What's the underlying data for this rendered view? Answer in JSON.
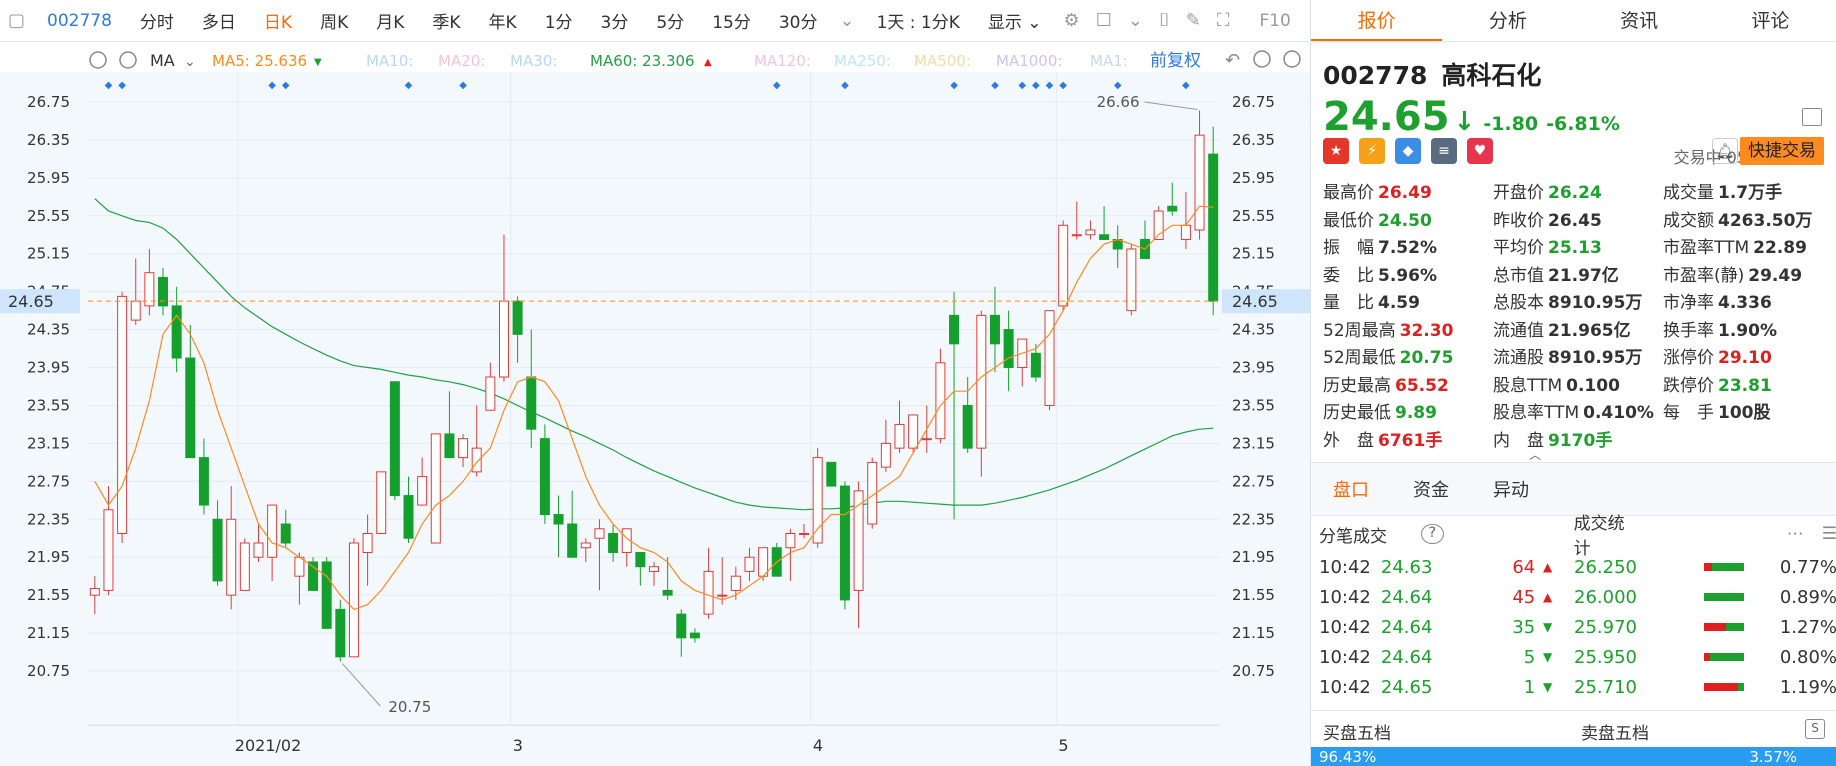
{
  "toolbar": {
    "code": "002778",
    "periods": [
      "分时",
      "多日",
      "日K",
      "周K",
      "月K",
      "季K",
      "年K",
      "1分",
      "3分",
      "5分",
      "15分",
      "30分"
    ],
    "active_period": "日K",
    "multi": "1天 : 1分K",
    "display": "显示",
    "f10": "F10"
  },
  "chart": {
    "ma_label": "MA",
    "ma_items": [
      {
        "label": "MA5: 25.636",
        "color": "#ff8a1f"
      },
      {
        "label": "MA10:",
        "color": "#b9d6f2"
      },
      {
        "label": "MA20:",
        "color": "#f3c3da"
      },
      {
        "label": "MA30:",
        "color": "#b9d6f2"
      },
      {
        "label": "MA60: 23.306",
        "color": "#23a045"
      },
      {
        "label": "MA120:",
        "color": "#f3c3da"
      },
      {
        "label": "MA250:",
        "color": "#bfe6f2"
      },
      {
        "label": "MA500:",
        "color": "#f6d9a6"
      },
      {
        "label": "MA1000:",
        "color": "#d3c2ea"
      },
      {
        "label": "MA1:",
        "color": "#c9d8e8"
      }
    ],
    "adjust": "前复权",
    "yticks": [
      "26.75",
      "26.35",
      "25.95",
      "25.55",
      "25.15",
      "24.75",
      "24.35",
      "23.95",
      "23.55",
      "23.15",
      "22.75",
      "22.35",
      "21.95",
      "21.55",
      "21.15",
      "20.75"
    ],
    "current_price_label": "24.65",
    "max_label": "26.66",
    "min_label": "20.75",
    "xlabels": [
      "2021/02",
      "3",
      "4",
      "5"
    ],
    "colors": {
      "up": "#e23b3b",
      "down": "#15a02e",
      "ma5": "#ff8a1f",
      "ma60": "#23a045",
      "bg": "#f3f8fd",
      "grid": "#e3ebf3",
      "marker": "#2c7be5"
    }
  },
  "chart_data": {
    "type": "candlestick",
    "ylim": [
      20.55,
      26.95
    ],
    "candles": [
      {
        "o": 21.55,
        "h": 21.75,
        "l": 21.35,
        "c": 21.62
      },
      {
        "o": 21.6,
        "h": 22.7,
        "l": 21.55,
        "c": 22.45
      },
      {
        "o": 22.2,
        "h": 24.75,
        "l": 22.1,
        "c": 24.7
      },
      {
        "o": 24.45,
        "h": 25.1,
        "l": 24.4,
        "c": 24.65
      },
      {
        "o": 24.6,
        "h": 25.2,
        "l": 24.5,
        "c": 24.95
      },
      {
        "o": 24.9,
        "h": 25.0,
        "l": 24.5,
        "c": 24.6
      },
      {
        "o": 24.6,
        "h": 24.8,
        "l": 23.9,
        "c": 24.05
      },
      {
        "o": 24.05,
        "h": 24.4,
        "l": 23.0,
        "c": 23.0
      },
      {
        "o": 23.0,
        "h": 23.2,
        "l": 22.4,
        "c": 22.5
      },
      {
        "o": 22.35,
        "h": 22.55,
        "l": 21.65,
        "c": 21.7
      },
      {
        "o": 21.55,
        "h": 22.7,
        "l": 21.4,
        "c": 22.35
      },
      {
        "o": 21.6,
        "h": 22.15,
        "l": 21.6,
        "c": 22.1
      },
      {
        "o": 21.95,
        "h": 22.3,
        "l": 21.9,
        "c": 22.1
      },
      {
        "o": 21.95,
        "h": 22.5,
        "l": 21.7,
        "c": 22.5
      },
      {
        "o": 22.3,
        "h": 22.45,
        "l": 22.05,
        "c": 22.1
      },
      {
        "o": 21.75,
        "h": 22.0,
        "l": 21.45,
        "c": 21.95
      },
      {
        "o": 21.9,
        "h": 21.95,
        "l": 21.6,
        "c": 21.6
      },
      {
        "o": 21.9,
        "h": 21.95,
        "l": 21.2,
        "c": 21.2
      },
      {
        "o": 21.4,
        "h": 21.5,
        "l": 20.85,
        "c": 20.9
      },
      {
        "o": 20.9,
        "h": 22.15,
        "l": 20.9,
        "c": 22.1
      },
      {
        "o": 22.0,
        "h": 22.4,
        "l": 21.65,
        "c": 22.2
      },
      {
        "o": 22.2,
        "h": 22.85,
        "l": 22.2,
        "c": 22.85
      },
      {
        "o": 23.8,
        "h": 23.8,
        "l": 22.55,
        "c": 22.6
      },
      {
        "o": 22.6,
        "h": 22.8,
        "l": 22.1,
        "c": 22.15
      },
      {
        "o": 22.5,
        "h": 23.0,
        "l": 22.5,
        "c": 22.8
      },
      {
        "o": 22.1,
        "h": 23.25,
        "l": 22.1,
        "c": 23.25
      },
      {
        "o": 23.25,
        "h": 23.7,
        "l": 23.0,
        "c": 23.0
      },
      {
        "o": 23.0,
        "h": 23.25,
        "l": 22.9,
        "c": 23.2
      },
      {
        "o": 22.85,
        "h": 23.55,
        "l": 22.8,
        "c": 23.1
      },
      {
        "o": 23.5,
        "h": 24.0,
        "l": 23.5,
        "c": 23.85
      },
      {
        "o": 23.85,
        "h": 25.35,
        "l": 23.8,
        "c": 24.65
      },
      {
        "o": 24.65,
        "h": 24.7,
        "l": 24.0,
        "c": 24.3
      },
      {
        "o": 23.85,
        "h": 24.35,
        "l": 23.1,
        "c": 23.3
      },
      {
        "o": 23.2,
        "h": 23.35,
        "l": 22.3,
        "c": 22.4
      },
      {
        "o": 22.4,
        "h": 22.6,
        "l": 21.95,
        "c": 22.3
      },
      {
        "o": 22.3,
        "h": 22.65,
        "l": 21.95,
        "c": 21.95
      },
      {
        "o": 22.05,
        "h": 22.15,
        "l": 21.9,
        "c": 22.1
      },
      {
        "o": 22.15,
        "h": 22.35,
        "l": 21.6,
        "c": 22.25
      },
      {
        "o": 22.2,
        "h": 22.3,
        "l": 21.9,
        "c": 22.0
      },
      {
        "o": 22.0,
        "h": 22.25,
        "l": 21.85,
        "c": 22.25
      },
      {
        "o": 22.0,
        "h": 22.0,
        "l": 21.65,
        "c": 21.85
      },
      {
        "o": 21.8,
        "h": 21.9,
        "l": 21.65,
        "c": 21.85
      },
      {
        "o": 21.6,
        "h": 21.95,
        "l": 21.5,
        "c": 21.55
      },
      {
        "o": 21.35,
        "h": 21.4,
        "l": 20.9,
        "c": 21.1
      },
      {
        "o": 21.15,
        "h": 21.2,
        "l": 21.05,
        "c": 21.1
      },
      {
        "o": 21.35,
        "h": 22.05,
        "l": 21.3,
        "c": 21.8
      },
      {
        "o": 21.55,
        "h": 21.95,
        "l": 21.45,
        "c": 21.55
      },
      {
        "o": 21.6,
        "h": 21.85,
        "l": 21.5,
        "c": 21.75
      },
      {
        "o": 21.8,
        "h": 22.05,
        "l": 21.7,
        "c": 21.95
      },
      {
        "o": 21.75,
        "h": 22.05,
        "l": 21.7,
        "c": 22.05
      },
      {
        "o": 22.05,
        "h": 22.1,
        "l": 21.75,
        "c": 21.75
      },
      {
        "o": 22.05,
        "h": 22.25,
        "l": 21.7,
        "c": 22.2
      },
      {
        "o": 22.2,
        "h": 22.3,
        "l": 22.15,
        "c": 22.2
      },
      {
        "o": 22.1,
        "h": 23.1,
        "l": 22.05,
        "c": 23.0
      },
      {
        "o": 22.95,
        "h": 22.95,
        "l": 22.7,
        "c": 22.7
      },
      {
        "o": 22.7,
        "h": 22.75,
        "l": 21.4,
        "c": 21.5
      },
      {
        "o": 21.6,
        "h": 22.75,
        "l": 21.2,
        "c": 22.65
      },
      {
        "o": 22.3,
        "h": 23.0,
        "l": 22.25,
        "c": 22.95
      },
      {
        "o": 22.9,
        "h": 23.4,
        "l": 22.85,
        "c": 23.15
      },
      {
        "o": 23.1,
        "h": 23.6,
        "l": 23.05,
        "c": 23.35
      },
      {
        "o": 23.1,
        "h": 23.45,
        "l": 23.05,
        "c": 23.45
      },
      {
        "o": 23.2,
        "h": 23.55,
        "l": 23.05,
        "c": 23.2
      },
      {
        "o": 23.2,
        "h": 24.15,
        "l": 23.15,
        "c": 24.0
      },
      {
        "o": 24.5,
        "h": 24.75,
        "l": 22.35,
        "c": 24.2
      },
      {
        "o": 23.55,
        "h": 23.85,
        "l": 23.05,
        "c": 23.1
      },
      {
        "o": 23.1,
        "h": 24.55,
        "l": 22.8,
        "c": 24.5
      },
      {
        "o": 24.5,
        "h": 24.8,
        "l": 23.9,
        "c": 24.2
      },
      {
        "o": 24.35,
        "h": 24.55,
        "l": 23.7,
        "c": 23.95
      },
      {
        "o": 23.95,
        "h": 24.25,
        "l": 23.75,
        "c": 24.25
      },
      {
        "o": 24.1,
        "h": 24.2,
        "l": 23.8,
        "c": 23.85
      },
      {
        "o": 23.55,
        "h": 24.55,
        "l": 23.5,
        "c": 24.55
      },
      {
        "o": 24.6,
        "h": 25.5,
        "l": 24.55,
        "c": 25.45
      },
      {
        "o": 25.35,
        "h": 25.7,
        "l": 25.3,
        "c": 25.35
      },
      {
        "o": 25.35,
        "h": 25.5,
        "l": 25.3,
        "c": 25.4
      },
      {
        "o": 25.35,
        "h": 25.65,
        "l": 25.3,
        "c": 25.3
      },
      {
        "o": 25.3,
        "h": 25.45,
        "l": 25.0,
        "c": 25.2
      },
      {
        "o": 24.55,
        "h": 25.25,
        "l": 24.5,
        "c": 25.2
      },
      {
        "o": 25.3,
        "h": 25.5,
        "l": 25.1,
        "c": 25.1
      },
      {
        "o": 25.3,
        "h": 25.65,
        "l": 25.3,
        "c": 25.6
      },
      {
        "o": 25.65,
        "h": 25.9,
        "l": 25.55,
        "c": 25.6
      },
      {
        "o": 25.3,
        "h": 25.8,
        "l": 25.2,
        "c": 25.45
      },
      {
        "o": 25.4,
        "h": 26.66,
        "l": 25.3,
        "c": 26.4
      },
      {
        "o": 26.2,
        "h": 26.49,
        "l": 24.5,
        "c": 24.65
      }
    ],
    "ma5": [
      22.75,
      22.5,
      22.7,
      23.1,
      23.6,
      24.3,
      24.5,
      24.3,
      24.0,
      23.5,
      23.1,
      22.7,
      22.3,
      22.1,
      22.05,
      21.95,
      21.85,
      21.75,
      21.55,
      21.4,
      21.45,
      21.6,
      21.8,
      22.0,
      22.3,
      22.5,
      22.6,
      22.75,
      22.95,
      23.1,
      23.5,
      23.8,
      23.85,
      23.8,
      23.6,
      23.2,
      22.8,
      22.5,
      22.3,
      22.15,
      22.05,
      22.0,
      21.9,
      21.7,
      21.6,
      21.55,
      21.5,
      21.55,
      21.65,
      21.75,
      21.9,
      22.0,
      22.05,
      22.25,
      22.4,
      22.4,
      22.5,
      22.6,
      22.7,
      22.8,
      23.05,
      23.3,
      23.55,
      23.7,
      23.7,
      23.85,
      23.95,
      24.05,
      24.1,
      24.15,
      24.3,
      24.55,
      24.85,
      25.1,
      25.25,
      25.3,
      25.25,
      25.2,
      25.35,
      25.45,
      25.45,
      25.65,
      25.64
    ],
    "ma60": [
      25.73,
      25.6,
      25.55,
      25.5,
      25.48,
      25.42,
      25.3,
      25.15,
      25.0,
      24.85,
      24.7,
      24.58,
      24.48,
      24.38,
      24.3,
      24.22,
      24.15,
      24.08,
      24.02,
      23.97,
      23.95,
      23.93,
      23.9,
      23.87,
      23.85,
      23.82,
      23.8,
      23.77,
      23.73,
      23.68,
      23.62,
      23.55,
      23.48,
      23.42,
      23.35,
      23.28,
      23.22,
      23.15,
      23.08,
      23.0,
      22.93,
      22.86,
      22.8,
      22.74,
      22.68,
      22.63,
      22.58,
      22.53,
      22.5,
      22.48,
      22.47,
      22.46,
      22.45,
      22.46,
      22.46,
      22.47,
      22.5,
      22.52,
      22.54,
      22.54,
      22.53,
      22.52,
      22.51,
      22.5,
      22.5,
      22.5,
      22.52,
      22.55,
      22.58,
      22.62,
      22.66,
      22.71,
      22.76,
      22.82,
      22.88,
      22.95,
      23.02,
      23.09,
      23.16,
      23.23,
      23.27,
      23.3,
      23.31
    ],
    "markers_candle_index": [
      1,
      2,
      13,
      14,
      23,
      27,
      50,
      55,
      63,
      66,
      68,
      69,
      70,
      71,
      75,
      80
    ]
  },
  "right": {
    "tabs": [
      "报价",
      "分析",
      "资讯",
      "评论"
    ],
    "active_tab": "报价",
    "code": "002778",
    "name": "高科石化",
    "price": "24.65",
    "change": "-1.80",
    "change_pct": "-6.81%",
    "status": "交易中 05/24 10:42",
    "fast_trade": "快捷交易",
    "stats": [
      [
        {
          "k": "最高价",
          "v": "26.49",
          "c": "red"
        },
        {
          "k": "开盘价",
          "v": "26.24",
          "c": "green"
        },
        {
          "k": "成交量",
          "v": "1.7万手",
          "c": "dark"
        }
      ],
      [
        {
          "k": "最低价",
          "v": "24.50",
          "c": "green"
        },
        {
          "k": "昨收价",
          "v": "26.45",
          "c": "dark"
        },
        {
          "k": "成交额",
          "v": "4263.50万",
          "c": "dark"
        }
      ],
      [
        {
          "k": "振　幅",
          "v": "7.52%",
          "c": "dark"
        },
        {
          "k": "平均价",
          "v": "25.13",
          "c": "green"
        },
        {
          "k": "市盈率TTM",
          "v": "22.89",
          "c": "dark"
        }
      ],
      [
        {
          "k": "委　比",
          "v": "5.96%",
          "c": "dark"
        },
        {
          "k": "总市值",
          "v": "21.97亿",
          "c": "dark"
        },
        {
          "k": "市盈率(静)",
          "v": "29.49",
          "c": "dark"
        }
      ],
      [
        {
          "k": "量　比",
          "v": "4.59",
          "c": "dark"
        },
        {
          "k": "总股本",
          "v": "8910.95万",
          "c": "dark"
        },
        {
          "k": "市净率",
          "v": "4.336",
          "c": "dark"
        }
      ],
      [
        {
          "k": "52周最高",
          "v": "32.30",
          "c": "red"
        },
        {
          "k": "流通值",
          "v": "21.965亿",
          "c": "dark"
        },
        {
          "k": "换手率",
          "v": "1.90%",
          "c": "dark"
        }
      ],
      [
        {
          "k": "52周最低",
          "v": "20.75",
          "c": "green"
        },
        {
          "k": "流通股",
          "v": "8910.95万",
          "c": "dark"
        },
        {
          "k": "涨停价",
          "v": "29.10",
          "c": "red"
        }
      ],
      [
        {
          "k": "历史最高",
          "v": "65.52",
          "c": "red"
        },
        {
          "k": "股息TTM",
          "v": "0.100",
          "c": "dark"
        },
        {
          "k": "跌停价",
          "v": "23.81",
          "c": "green"
        }
      ],
      [
        {
          "k": "历史最低",
          "v": "9.89",
          "c": "green"
        },
        {
          "k": "股息率TTM",
          "v": "0.410%",
          "c": "dark"
        },
        {
          "k": "每　手",
          "v": "100股",
          "c": "dark"
        }
      ],
      [
        {
          "k": "外　盘",
          "v": "6761手",
          "c": "red"
        },
        {
          "k": "内　盘",
          "v": "9170手",
          "c": "green"
        },
        {
          "k": "",
          "v": "",
          "c": "dark"
        }
      ]
    ],
    "tabs2": [
      "盘口",
      "资金",
      "异动"
    ],
    "active_tab2": "盘口",
    "trade_head_left": "分笔成交",
    "trade_head_right": "成交统计",
    "trades": [
      {
        "t": "10:42",
        "p": "24.63",
        "v": "64",
        "dir": "up",
        "sp": "26.250",
        "pc": "0.77%",
        "r": 0.2
      },
      {
        "t": "10:42",
        "p": "24.64",
        "v": "45",
        "dir": "up",
        "sp": "26.000",
        "pc": "0.89%",
        "r": 0.0
      },
      {
        "t": "10:42",
        "p": "24.64",
        "v": "35",
        "dir": "down",
        "sp": "25.970",
        "pc": "1.27%",
        "r": 0.55
      },
      {
        "t": "10:42",
        "p": "24.64",
        "v": "5",
        "dir": "down",
        "sp": "25.950",
        "pc": "0.80%",
        "r": 0.15
      },
      {
        "t": "10:42",
        "p": "24.65",
        "v": "1",
        "dir": "down",
        "sp": "25.710",
        "pc": "1.19%",
        "r": 0.85
      }
    ],
    "book_left": "买盘五档",
    "book_right": "卖盘五档",
    "buy_pct": "96.43%",
    "sell_pct": "3.57%"
  }
}
